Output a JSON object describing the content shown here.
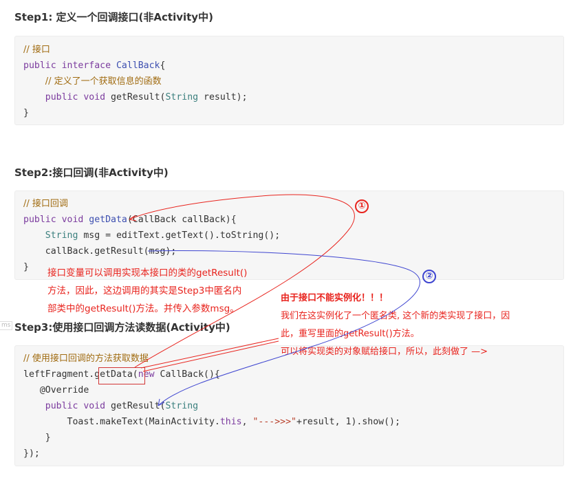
{
  "step1": {
    "heading": "Step1: 定义一个回调接口(非Activity中)",
    "code": [
      [
        [
          "cm",
          "// 接口"
        ]
      ],
      [
        [
          "kw",
          "public "
        ],
        [
          "kw",
          "interface "
        ],
        [
          "fn",
          "CallBack"
        ],
        [
          "",
          "{"
        ]
      ],
      [
        [
          "",
          "    "
        ],
        [
          "cm",
          "// 定义了一个获取信息的函数"
        ]
      ],
      [
        [
          "",
          "    "
        ],
        [
          "kw",
          "public "
        ],
        [
          "kw",
          "void "
        ],
        [
          "",
          "getResult("
        ],
        [
          "ty",
          "String"
        ],
        [
          "",
          " result);"
        ]
      ],
      [
        [
          "",
          "}"
        ]
      ]
    ]
  },
  "step2": {
    "heading": "Step2:接口回调(非Activity中)",
    "code": [
      [
        [
          "cm",
          "// 接口回调"
        ]
      ],
      [
        [
          "kw",
          "public "
        ],
        [
          "kw",
          "void "
        ],
        [
          "fn",
          "getData"
        ],
        [
          "",
          "(CallBack callBack){"
        ]
      ],
      [
        [
          "",
          "    "
        ],
        [
          "ty",
          "String"
        ],
        [
          "",
          " msg = editText.getText().toString();"
        ]
      ],
      [
        [
          "",
          "    callBack.getResult(msg);"
        ]
      ],
      [
        [
          "",
          "}"
        ]
      ]
    ],
    "note_lines": [
      "接口变量可以调用实现本接口的类的getResult()",
      "方法，因此，这边调用的其实是Step3中匿名内",
      "部类中的getResult()方法。并传入参数msg。"
    ]
  },
  "step3": {
    "heading": "Step3:使用接口回调方法读数据(Activity中)",
    "code": [
      [
        [
          "cm",
          "// 使用接口回调的方法获取数据"
        ]
      ],
      [
        [
          "",
          "leftFragment."
        ],
        [
          "",
          "getData"
        ],
        [
          "",
          ""
        ],
        [
          "kw",
          "new "
        ],
        [
          "",
          "CallBack(){"
        ]
      ],
      [
        [
          "",
          "   @Override"
        ]
      ],
      [
        [
          "",
          "    "
        ],
        [
          "kw",
          "public "
        ],
        [
          "kw",
          "void "
        ],
        [
          "",
          "getResult("
        ],
        [
          "ty",
          "String"
        ],
        [
          "",
          "",
          " result){"
        ]
      ],
      [
        [
          "",
          "        Toast.makeText(MainActivity."
        ],
        [
          "kw",
          "this"
        ],
        [
          "",
          ", "
        ],
        [
          "st",
          "\"--->>>\""
        ],
        [
          "",
          "+result, "
        ],
        [
          "num",
          "1"
        ],
        [
          "",
          ").show();"
        ]
      ],
      [
        [
          "",
          "    }"
        ]
      ],
      [
        [
          "",
          "});"
        ]
      ]
    ]
  },
  "annotation": {
    "bold_line": "由于接口不能实例化！！！",
    "lines": [
      "我们在这实例化了一个匿名类, 这个新的类实现了接口，因",
      "此，重写里面的getResult()方法。",
      "可以将实现类的对象赋给接口，所以，此刻做了 —>"
    ],
    "badge1": "①",
    "badge2": "②"
  },
  "side_tag": "ms",
  "colors": {
    "annotation_red": "#e8231d",
    "annotation_blue": "#3d44d0",
    "code_bg": "#f6f6f6"
  }
}
